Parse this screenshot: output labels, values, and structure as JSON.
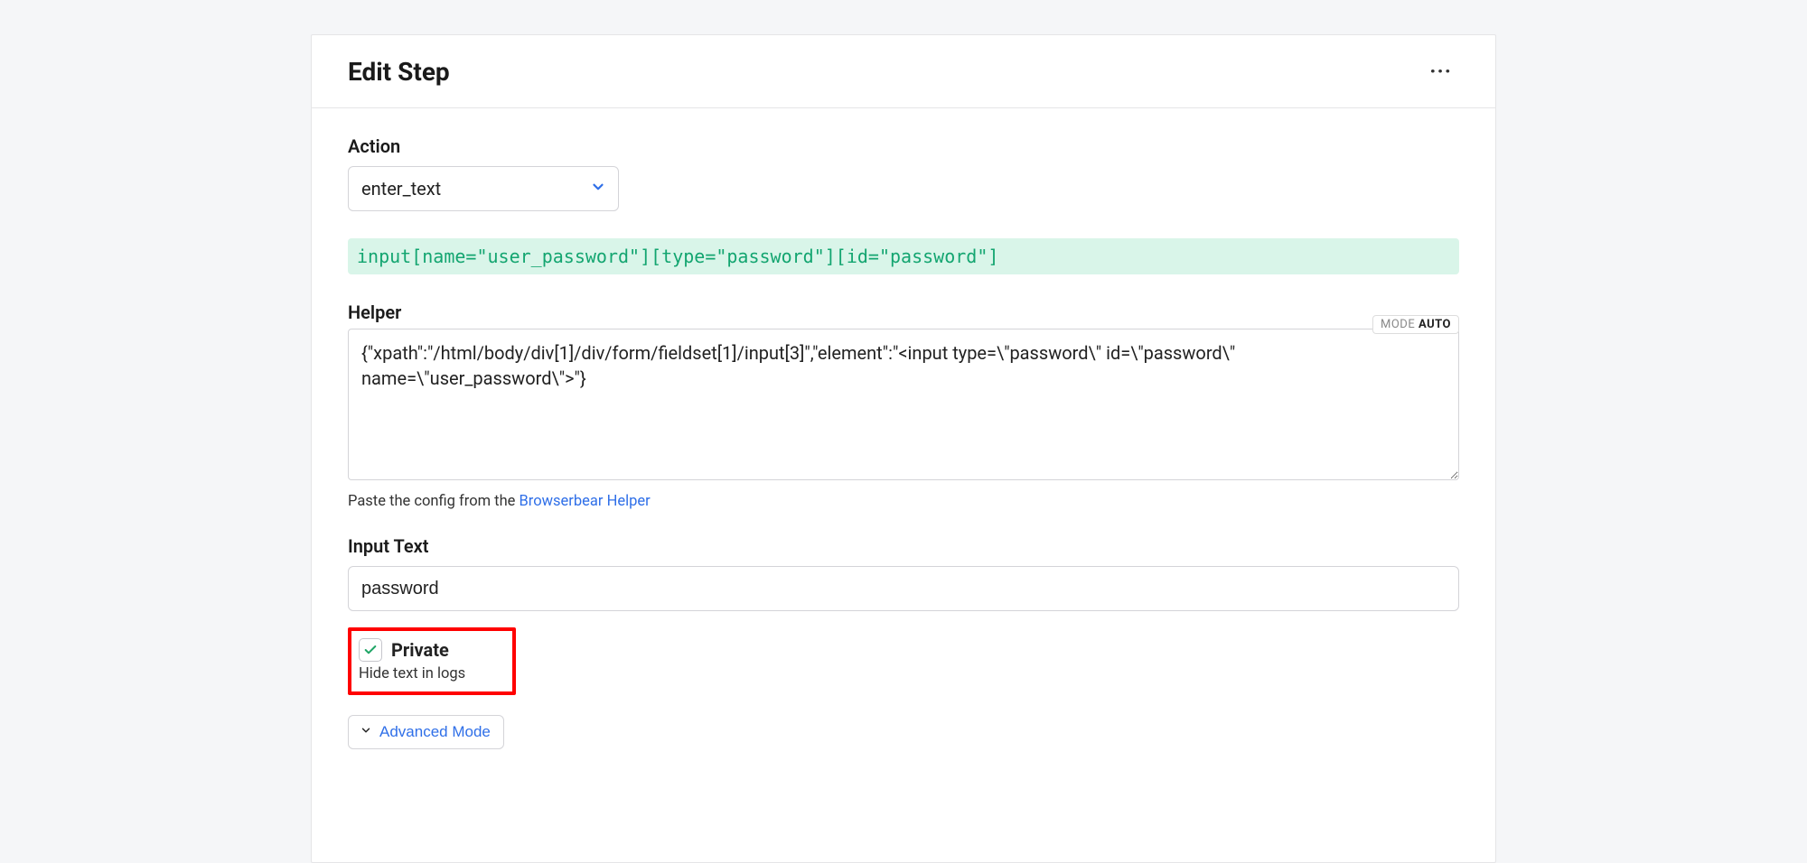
{
  "header": {
    "title": "Edit Step"
  },
  "action": {
    "label": "Action",
    "value": "enter_text"
  },
  "selector": {
    "text": "input[name=\"user_password\"][type=\"password\"][id=\"password\"]"
  },
  "helper": {
    "label": "Helper",
    "mode_prefix": "MODE ",
    "mode_value": "AUTO",
    "value": "{\"xpath\":\"/html/body/div[1]/div/form/fieldset[1]/input[3]\",\"element\":\"<input type=\\\"password\\\" id=\\\"password\\\" name=\\\"user_password\\\">\"}",
    "hint_prefix": "Paste the config from the ",
    "hint_link": "Browserbear Helper"
  },
  "input_text": {
    "label": "Input Text",
    "value": "password"
  },
  "private": {
    "label": "Private",
    "hint": "Hide text in logs",
    "checked": true
  },
  "advanced": {
    "label": "Advanced Mode"
  }
}
